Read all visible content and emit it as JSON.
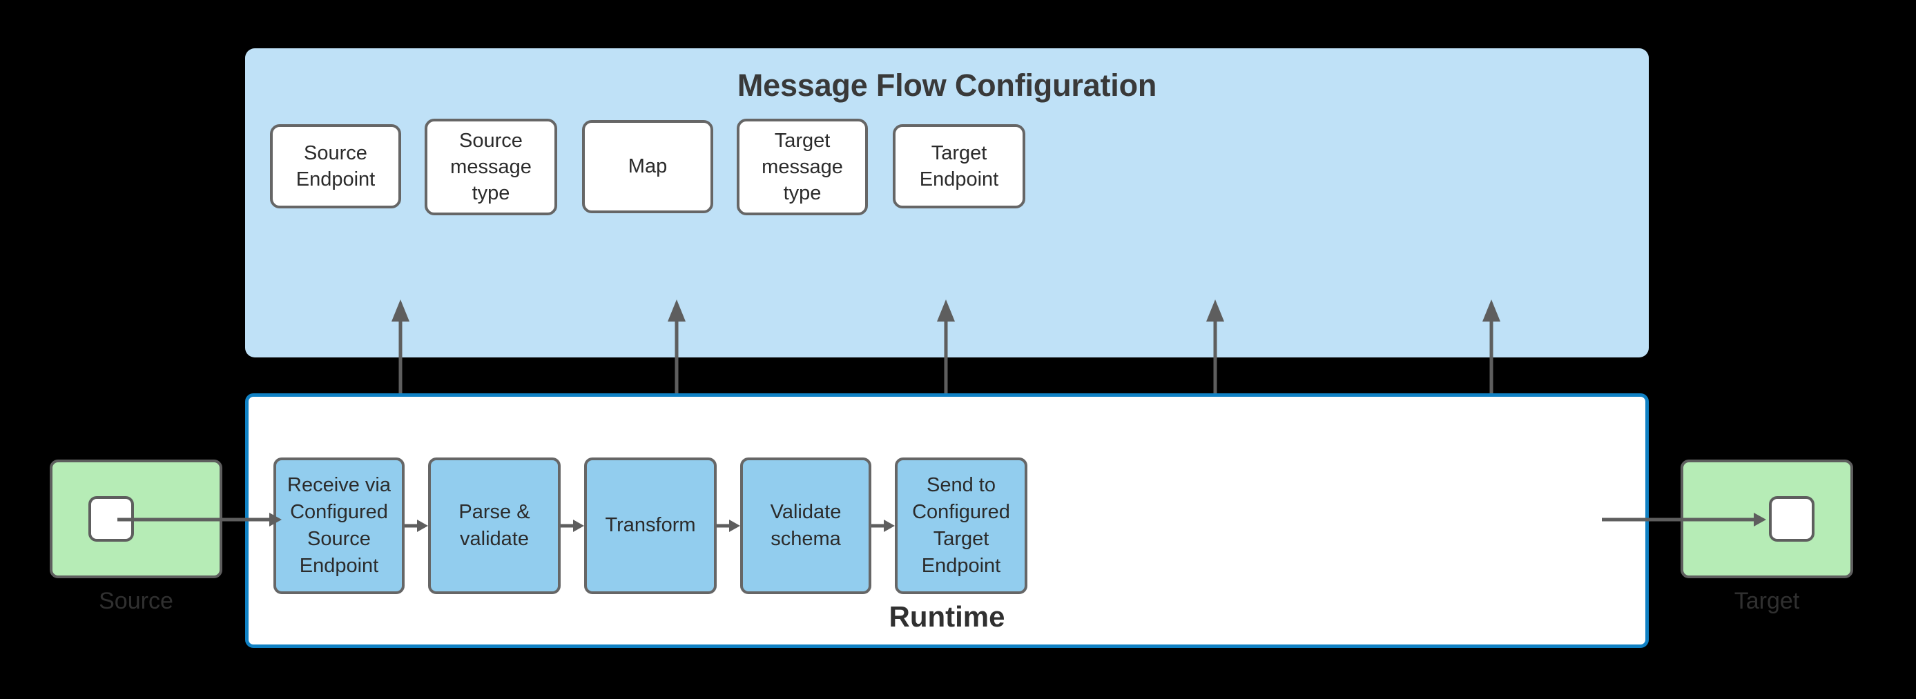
{
  "diagram": {
    "background_color": "#000000",
    "config_panel": {
      "title": "Message Flow Configuration",
      "fill_color": "#bfe1f7",
      "boxes": [
        {
          "label": "Source Endpoint",
          "name": "source-endpoint"
        },
        {
          "label": "Source message type",
          "name": "source-message-type"
        },
        {
          "label": "Map",
          "name": "map"
        },
        {
          "label": "Target message type",
          "name": "target-message-type"
        },
        {
          "label": "Target Endpoint",
          "name": "target-endpoint"
        }
      ]
    },
    "runtime_panel": {
      "title": "Runtime",
      "border_color": "#1081c4",
      "fill_color": "#ffffff",
      "steps": [
        {
          "label": "Receive via Configured Source Endpoint",
          "name": "receive-via-configured-source-endpoint"
        },
        {
          "label": "Parse & validate",
          "name": "parse-and-validate"
        },
        {
          "label": "Transform",
          "name": "transform"
        },
        {
          "label": "Validate schema",
          "name": "validate-schema"
        },
        {
          "label": "Send to Configured Target Endpoint",
          "name": "send-to-configured-target-endpoint"
        }
      ],
      "step_fill_color": "#92cdee"
    },
    "endpoints": [
      {
        "label": "Source",
        "name": "source-node",
        "fill_color": "#b6ecb6"
      },
      {
        "label": "Target",
        "name": "target-node",
        "fill_color": "#b6ecb6"
      }
    ],
    "connector_color": "#5e5e5e"
  }
}
